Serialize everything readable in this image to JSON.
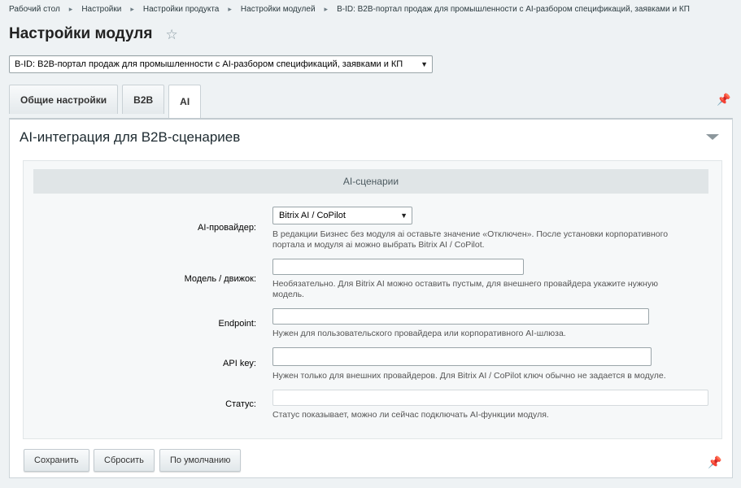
{
  "breadcrumb": [
    "Рабочий стол",
    "Настройки",
    "Настройки продукта",
    "Настройки модулей",
    "B-ID: B2B-портал продаж для промышленности с AI-разбором спецификаций, заявками и КП"
  ],
  "page_title": "Настройки модуля",
  "module_select": "B-ID: B2B-портал продаж для промышленности с AI-разбором спецификаций, заявками и КП",
  "tabs": [
    "Общие настройки",
    "B2B",
    "AI"
  ],
  "active_tab": "AI",
  "section_title": "AI-интеграция для B2B-сценариев",
  "group_title": "AI-сценарии",
  "fields": {
    "provider": {
      "label": "AI-провайдер:",
      "value": "Bitrix AI / CoPilot",
      "hint1": "В редакции Бизнес без модуля ai оставьте значение «Отключен». После установки корпоративного",
      "hint2": "портала и модуля ai можно выбрать Bitrix AI / CoPilot."
    },
    "model": {
      "label": "Модель / движок:",
      "value": "",
      "hint1": "Необязательно. Для Bitrix AI можно оставить пустым, для внешнего провайдера укажите нужную",
      "hint2": "модель."
    },
    "endpoint": {
      "label": "Endpoint:",
      "value": "",
      "hint": "Нужен для пользовательского провайдера или корпоративного AI-шлюза."
    },
    "api_key": {
      "label": "API key:",
      "value": "",
      "hint": "Нужен только для внешних провайдеров. Для Bitrix AI / CoPilot ключ обычно не задается в модуле."
    },
    "status": {
      "label": "Статус:",
      "value": "",
      "hint": "Статус показывает, можно ли сейчас подключать AI-функции модуля."
    }
  },
  "buttons": {
    "save": "Сохранить",
    "reset": "Сбросить",
    "default": "По умолчанию"
  },
  "icons": {
    "favorite": "star-icon",
    "pin": "pin-icon",
    "collapse": "collapse-arrow-icon",
    "dropdown": "chevron-down-icon"
  }
}
